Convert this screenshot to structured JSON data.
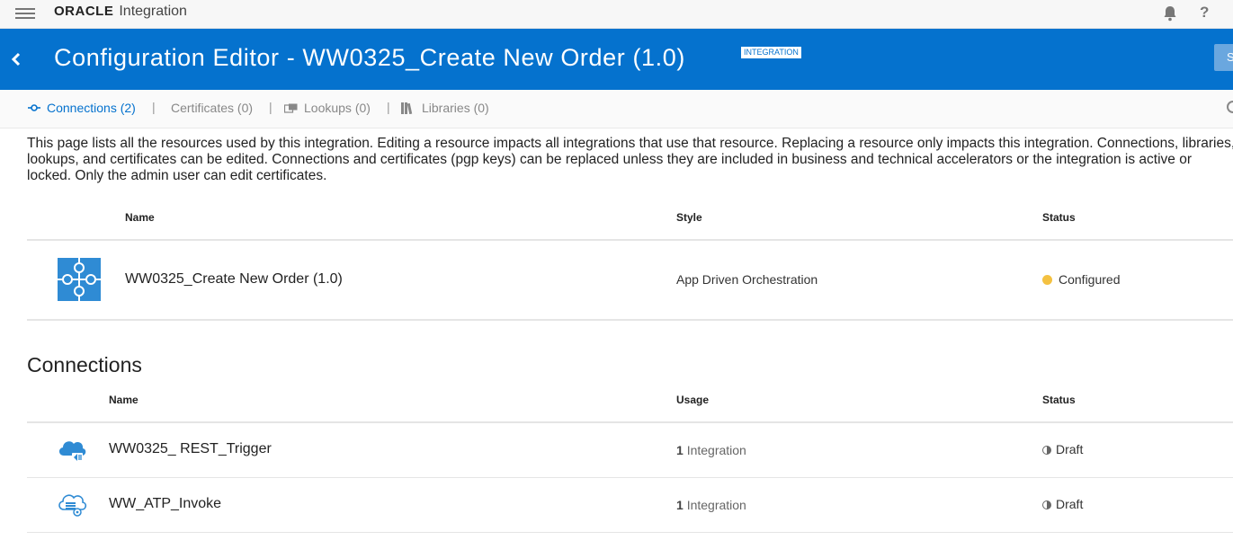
{
  "app": {
    "brand": "ORACLE",
    "product": "Integration"
  },
  "header": {
    "title": "Configuration Editor - WW0325_Create New Order (1.0)",
    "badge": "INTEGRATION",
    "save_label": "S"
  },
  "tabs": [
    {
      "label": "Connections (2)",
      "active": true
    },
    {
      "label": "Certificates (0)",
      "active": false
    },
    {
      "label": "Lookups (0)",
      "active": false
    },
    {
      "label": "Libraries (0)",
      "active": false
    }
  ],
  "tab_separator": "|",
  "description": "This page lists all the resources used by this integration. Editing a resource impacts all integrations that use that resource. Replacing a resource only impacts this integration. Connections, libraries, lookups, and certificates can be edited. Connections and certificates (pgp keys) can be replaced unless they are included in business and technical accelerators or the integration is active or locked. Only the admin user can edit certificates.",
  "integration_table": {
    "columns": {
      "name": "Name",
      "style": "Style",
      "status": "Status"
    },
    "rows": [
      {
        "name": "WW0325_Create New Order (1.0)",
        "style": "App Driven Orchestration",
        "status": "Configured",
        "icon": "puzzle-icon"
      }
    ]
  },
  "connections": {
    "title": "Connections",
    "columns": {
      "name": "Name",
      "usage": "Usage",
      "status": "Status"
    },
    "rows": [
      {
        "name": "WW0325_ REST_Trigger",
        "usage_count": "1",
        "usage_label": "Integration",
        "status": "Draft",
        "icon": "rest-cloud-icon"
      },
      {
        "name": "WW_ATP_Invoke",
        "usage_count": "1",
        "usage_label": "Integration",
        "status": "Draft",
        "icon": "database-cloud-icon"
      }
    ]
  },
  "colors": {
    "header_bg": "#0572ce",
    "accent": "#0572ce",
    "configured_dot": "#f4c141",
    "puzzle_icon": "#2f8bd4"
  }
}
